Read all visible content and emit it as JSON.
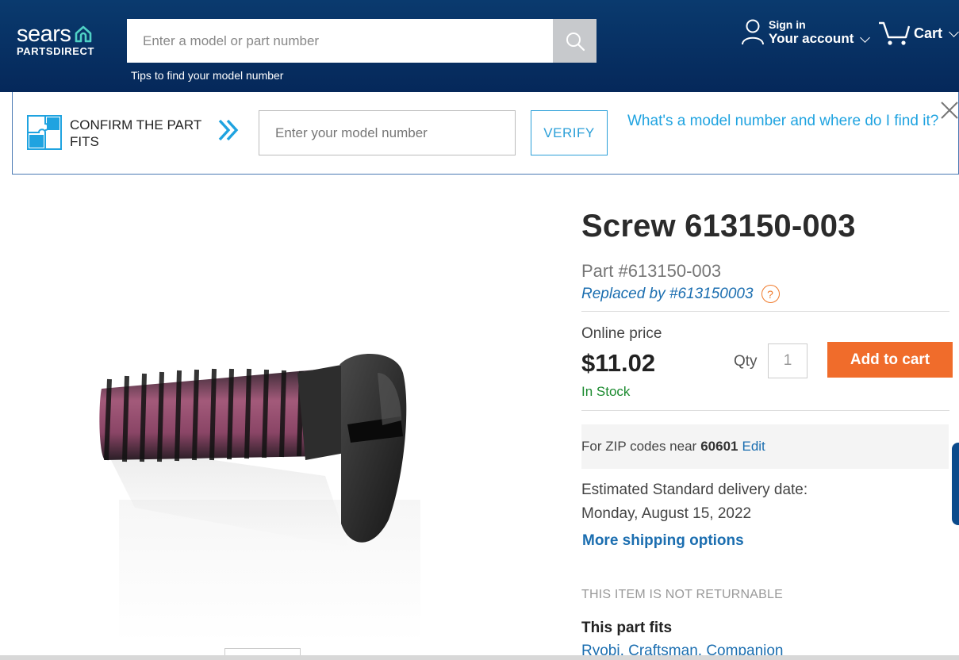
{
  "header": {
    "logo_word": "sears",
    "logo_sub": "PARTSDIRECT",
    "search_placeholder": "Enter a model or part number",
    "tips_link": "Tips to find your model number",
    "account_small": "Sign in",
    "account_big": "Your account",
    "cart_label": "Cart"
  },
  "confirm_bar": {
    "title": "CONFIRM THE PART FITS",
    "model_placeholder": "Enter your model number",
    "verify_label": "VERIFY",
    "help_link": "What's a model number and where do I find it?"
  },
  "product": {
    "title": "Screw 613150-003",
    "part_number": "Part #613150-003",
    "replaced_by": "Replaced by #613150003",
    "help_icon": "?",
    "online_price_label": "Online price",
    "price": "$11.02",
    "stock": "In Stock",
    "qty_label": "Qty",
    "qty_value": "1",
    "add_to_cart": "Add to cart",
    "zip_prefix": "For ZIP codes near",
    "zip": "60601",
    "zip_edit": "Edit",
    "delivery_label": "Estimated Standard delivery date:",
    "delivery_date": "Monday, August 15, 2022",
    "more_shipping": "More shipping options",
    "not_returnable": "THIS ITEM IS NOT RETURNABLE",
    "fits_heading": "This part fits",
    "fits_brands": "Ryobi, Craftsman, Companion"
  },
  "colors": {
    "header_bg": "#05285a",
    "accent_blue": "#1fa3e0",
    "link_blue": "#1b6eb0",
    "cta_orange": "#f06c2b",
    "in_stock_green": "#1a8a2e"
  }
}
